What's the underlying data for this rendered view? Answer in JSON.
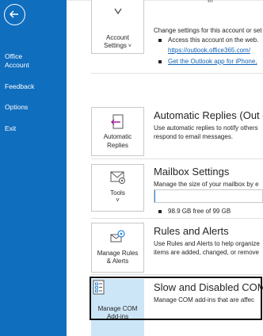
{
  "nav": {
    "items": [
      {
        "label": "Office\nAccount"
      },
      {
        "label": "Feedback"
      },
      {
        "label": "Options"
      },
      {
        "label": "Exit"
      }
    ]
  },
  "top_ghost": "In",
  "account_settings": {
    "tile_label_line1": "Account",
    "tile_label_line2": "Settings",
    "description": "Change settings for this account or set",
    "bullets": [
      {
        "text": "Access this account on the web.",
        "link": false
      },
      {
        "text": "https://outlook.office365.com/",
        "link": true
      },
      {
        "text": "Get the Outlook app for iPhone,",
        "link": true
      }
    ]
  },
  "automatic_replies": {
    "tile_label_line1": "Automatic",
    "tile_label_line2": "Replies",
    "title": "Automatic Replies (Out o",
    "desc_line1": "Use automatic replies to notify others",
    "desc_line2": "respond to email messages."
  },
  "mailbox_settings": {
    "tile_label": "Tools",
    "title": "Mailbox Settings",
    "desc": "Manage the size of your mailbox by e",
    "usage": "98.9 GB free of 99 GB",
    "fill_fraction": 0.011
  },
  "rules_alerts": {
    "tile_label_line1": "Manage Rules",
    "tile_label_line2": "& Alerts",
    "title": "Rules and Alerts",
    "desc_line1": "Use Rules and Alerts to help organize",
    "desc_line2": "items are added, changed, or remove"
  },
  "com_addins": {
    "tile_label_line1": "Manage COM",
    "tile_label_line2": "Add-ins",
    "title": "Slow and Disabled COM",
    "desc": "Manage COM add-ins that are affec"
  }
}
